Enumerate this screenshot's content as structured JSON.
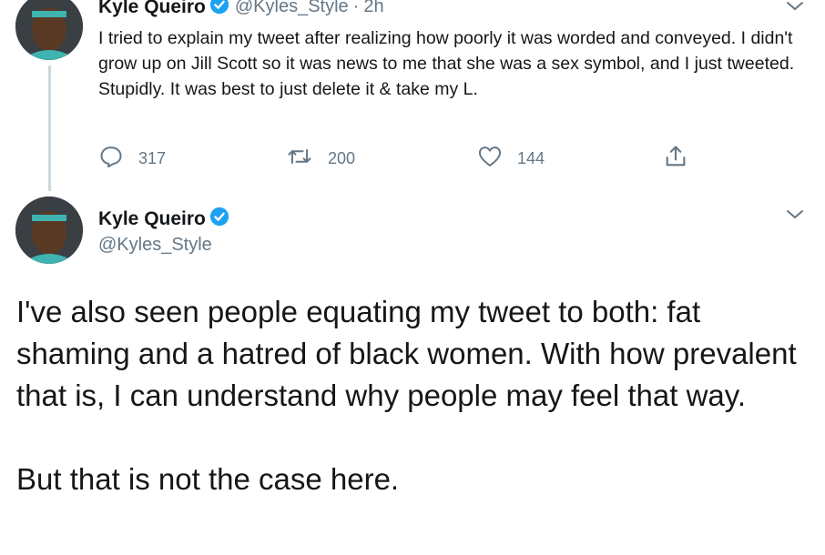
{
  "colors": {
    "text": "#14171a",
    "secondary": "#657786",
    "verified": "#1da1f2",
    "thread_line": "#ccd6dd"
  },
  "tweet1": {
    "author_name": "Kyle Queiro",
    "handle": "@Kyles_Style",
    "separator": "·",
    "time": "2h",
    "text": "I tried to explain my tweet after realizing how poorly it was worded and conveyed. I didn't grow up on Jill Scott so it was news to me that she was a sex symbol, and I just tweeted. Stupidly. It was best to just delete it & take my L.",
    "actions": {
      "reply_icon": "reply-icon",
      "reply_count": "317",
      "retweet_icon": "retweet-icon",
      "retweet_count": "200",
      "like_icon": "heart-icon",
      "like_count": "144",
      "share_icon": "share-icon"
    }
  },
  "tweet2": {
    "author_name": "Kyle Queiro",
    "handle": "@Kyles_Style",
    "paragraphs": [
      "I've also seen people equating my tweet to both: fat shaming and a hatred of black women. With how prevalent that is, I can understand why people may feel that way.",
      "But that is not the case here."
    ]
  }
}
